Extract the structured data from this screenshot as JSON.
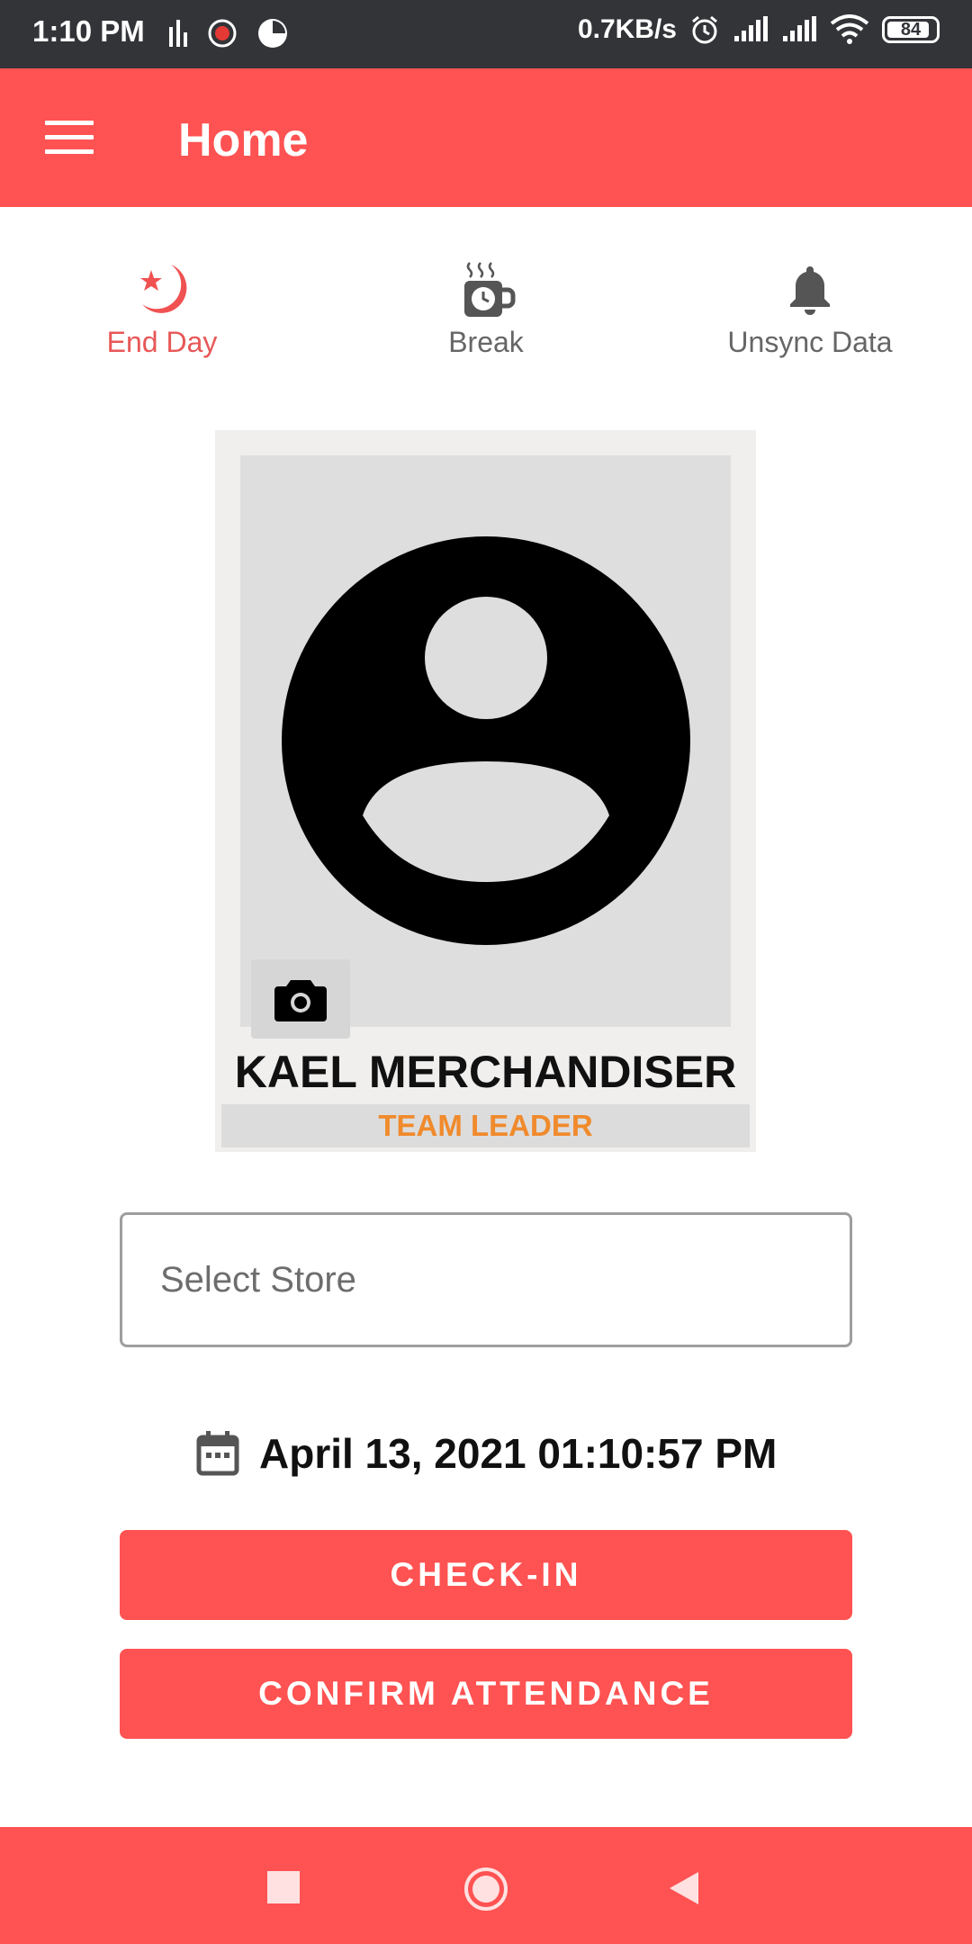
{
  "status_bar": {
    "time": "1:10 PM",
    "net_speed": "0.7KB/s",
    "battery": "84"
  },
  "app_bar": {
    "title": "Home"
  },
  "actions": {
    "end_day": "End Day",
    "break": "Break",
    "unsync": "Unsync Data"
  },
  "profile": {
    "name": "KAEL MERCHANDISER",
    "role": "TEAM LEADER"
  },
  "store_select": {
    "placeholder": "Select Store"
  },
  "datetime": "April 13, 2021 01:10:57 PM",
  "buttons": {
    "check_in": "CHECK-IN",
    "confirm": "CONFIRM ATTENDANCE"
  },
  "colors": {
    "primary": "#ff5252",
    "role_text": "#f08a2c",
    "status_bar": "#333438"
  }
}
